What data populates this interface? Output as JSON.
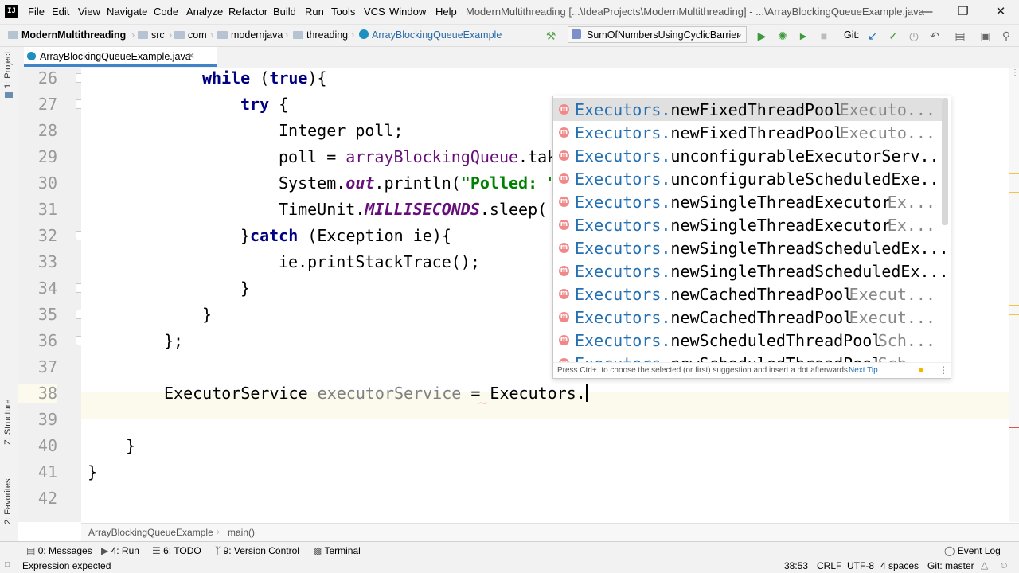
{
  "menubar": {
    "items": [
      "File",
      "Edit",
      "View",
      "Navigate",
      "Code",
      "Analyze",
      "Refactor",
      "Build",
      "Run",
      "Tools",
      "VCS",
      "Window",
      "Help"
    ],
    "title": "ModernMultithreading [...\\IdeaProjects\\ModernMultithreading] - ...\\ArrayBlockingQueueExample.java"
  },
  "navbar": {
    "crumbs": [
      "ModernMultithreading",
      "src",
      "com",
      "modernjava",
      "threading",
      "ArrayBlockingQueueExample"
    ],
    "run_config": "SumOfNumbersUsingCyclicBarrier",
    "vcs_label": "Git:"
  },
  "tab": {
    "label": "ArrayBlockingQueueExample.java"
  },
  "left_tools": {
    "project": "1: Project",
    "structure": "Z: Structure",
    "favorites": "2: Favorites"
  },
  "editor": {
    "line_numbers": [
      "26",
      "27",
      "28",
      "29",
      "30",
      "31",
      "32",
      "33",
      "34",
      "35",
      "36",
      "37",
      "38",
      "39",
      "40",
      "41",
      "42"
    ],
    "lines": {
      "l26_kw1": "while",
      "l26_p1": " (",
      "l26_kw2": "true",
      "l26_p2": "){",
      "l27_kw": "try",
      "l27_p": " {",
      "l28": "Integer poll;",
      "l29_a": "poll = ",
      "l29_b": "arrayBlockingQueue",
      "l29_c": ".tak",
      "l30_a": "System.",
      "l30_b": "out",
      "l30_c": ".println(",
      "l30_d": "\"Polled: \"",
      "l31_a": "TimeUnit.",
      "l31_b": "MILLISECONDS",
      "l31_c": ".sleep(",
      "l32_a": "}",
      "l32_kw": "catch",
      "l32_b": " (Exception ie){",
      "l33": "ie.printStackTrace();",
      "l34": "}",
      "l35": "}",
      "l36": "};",
      "l38_a": "ExecutorService ",
      "l38_b": "executorService",
      "l38_c": " = ",
      "l38_d": "Executors.",
      "l40": "}",
      "l41": "}"
    }
  },
  "completion": {
    "qualifier": "Executors.",
    "items": [
      {
        "method": "newFixedThreadPool",
        "type": "Executo..."
      },
      {
        "method": "newFixedThreadPool",
        "type": "Executo..."
      },
      {
        "method": "unconfigurableExecutorServ...",
        "type": ""
      },
      {
        "method": "unconfigurableScheduledExe...",
        "type": ""
      },
      {
        "method": "newSingleThreadExecutor",
        "type": "Ex..."
      },
      {
        "method": "newSingleThreadExecutor",
        "type": "Ex..."
      },
      {
        "method": "newSingleThreadScheduledEx...",
        "type": ""
      },
      {
        "method": "newSingleThreadScheduledEx...",
        "type": ""
      },
      {
        "method": "newCachedThreadPool",
        "type": "Execut..."
      },
      {
        "method": "newCachedThreadPool",
        "type": "Execut..."
      },
      {
        "method": "newScheduledThreadPool",
        "type": "Sch..."
      },
      {
        "method": "newScheduledThreadPool",
        "type": "Sch..."
      }
    ],
    "icon_letter": "m",
    "hint": "Press Ctrl+. to choose the selected (or first) suggestion and insert a dot afterwards",
    "next_tip": "Next Tip"
  },
  "editcrumbs": {
    "class": "ArrayBlockingQueueExample",
    "method": "main()"
  },
  "toolwindows": {
    "messages_num": "0",
    "messages": ": Messages",
    "run_num": "4",
    "run": ": Run",
    "todo_num": "6",
    "todo": ": TODO",
    "vc_num": "9",
    "vc": ": Version Control",
    "terminal": "Terminal",
    "event_log": "Event Log"
  },
  "status": {
    "message": "Expression expected",
    "position": "38:53",
    "line_sep": "CRLF",
    "encoding": "UTF-8",
    "indent": "4 spaces",
    "git": "Git: master"
  },
  "colors": {
    "accent": "#4083c9",
    "keyword": "#000080",
    "string": "#008000",
    "static": "#660e7a",
    "completion_qualifier": "#2470b3"
  }
}
